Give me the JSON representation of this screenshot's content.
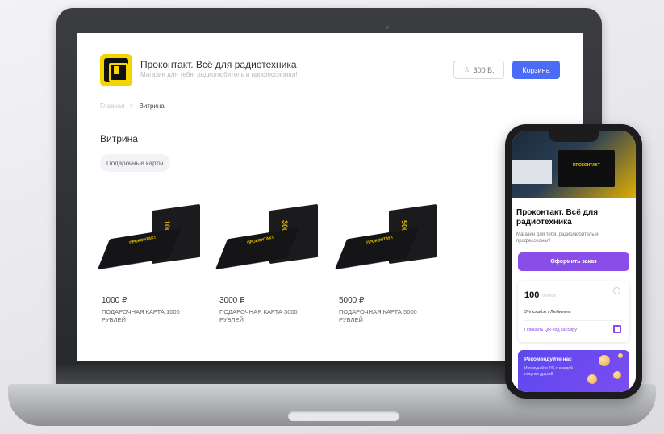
{
  "site": {
    "title": "Проконтакт. Всё для радиотехника",
    "subtitle": "Магазин для тебя, радиолюбитель и профессионал!",
    "points_label": "300 Б.",
    "cart_label": "Корзина"
  },
  "breadcrumb": {
    "home": "Главная",
    "separator": ">",
    "current": "Витрина"
  },
  "page": {
    "title": "Витрина",
    "category_chip": "Подарочные карты"
  },
  "products": [
    {
      "price": "1000 ₽",
      "name": "ПОДАРОЧНАЯ КАРТА 1000 РУБЛЕЙ",
      "card_number": "1000"
    },
    {
      "price": "3000 ₽",
      "name": "ПОДАРОЧНАЯ КАРТА 3000 РУБЛЕЙ",
      "card_number": "3000"
    },
    {
      "price": "5000 ₽",
      "name": "ПОДАРОЧНАЯ КАРТА 5000 РУБЛЕЙ",
      "card_number": "5000"
    }
  ],
  "card_brand": "ПРОКОНТАКТ",
  "phone": {
    "title": "Проконтакт. Всё для радиотехника",
    "subtitle": "Магазин для тебя, радиолюбитель и профессионал!",
    "order_button": "Оформить заказ",
    "bonus_value": "100",
    "bonus_unit": "баллов",
    "cashback": "3% кэшбэк / Любитель",
    "qr_link": "Показать QR-код кассиру",
    "recommend_title": "Рекомендуйте нас",
    "recommend_sub": "И получайте 1% с каждой покупки друзей"
  },
  "colors": {
    "accent_blue": "#4a6cf7",
    "accent_purple": "#8a4de8",
    "brand_yellow": "#f5d400"
  }
}
